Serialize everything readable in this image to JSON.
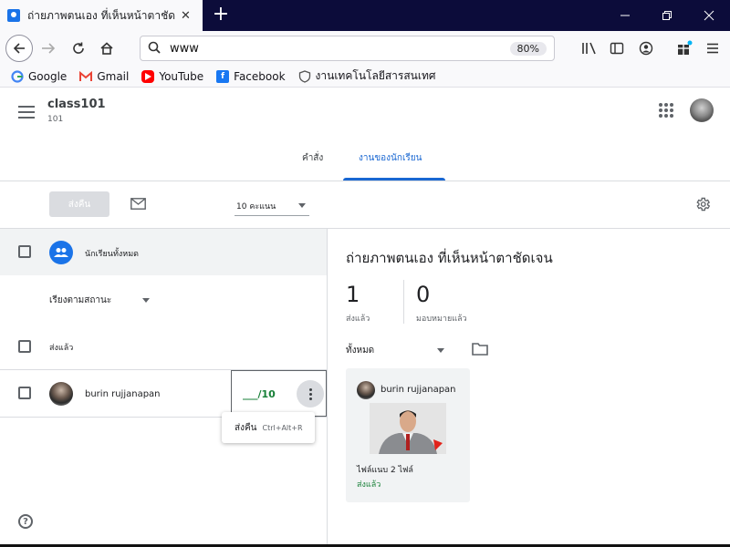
{
  "browser": {
    "tab_title": "ถ่ายภาพตนเอง ที่เห็นหน้าตาชัดเจน",
    "tab_close": "✕",
    "new_tab": "+",
    "url": "www",
    "zoom": "80%",
    "bookmarks": [
      {
        "label": "Google",
        "icon": "google-icon",
        "color": "#4285f4"
      },
      {
        "label": "Gmail",
        "icon": "gmail-icon",
        "color": "#ea4335"
      },
      {
        "label": "YouTube",
        "icon": "youtube-icon",
        "color": "#ff0000"
      },
      {
        "label": "Facebook",
        "icon": "facebook-icon",
        "color": "#1877f2"
      },
      {
        "label": "งานเทคโนโลยีสารสนเทศ",
        "icon": "shield-icon",
        "color": "#555555"
      }
    ]
  },
  "classroom": {
    "class_name": "class101",
    "section": "101",
    "tabs": [
      {
        "label": "คำสั่ง",
        "active": false
      },
      {
        "label": "งานของนักเรียน",
        "active": true
      }
    ],
    "accent_color": "#1967d2",
    "toolbar": {
      "return_label": "ส่งคืน",
      "points": "10 คะแนน"
    },
    "left": {
      "all_students": "นักเรียนทั้งหมด",
      "sort_by": "เรียงตามสถานะ",
      "section_turned_in": "ส่งแล้ว",
      "student": {
        "name": "burin rujjanapan",
        "grade": "___/10"
      },
      "menu": {
        "label": "ส่งคืน",
        "shortcut": "Ctrl+Alt+R"
      },
      "help": "?"
    },
    "right": {
      "assignment_title": "ถ่ายภาพตนเอง ที่เห็นหน้าตาชัดเจน",
      "turned_in_count": "1",
      "turned_in_label": "ส่งแล้ว",
      "assigned_count": "0",
      "assigned_label": "มอบหมายแล้ว",
      "filter": "ทั้งหมด",
      "card": {
        "student_name": "burin rujjanapan",
        "attachments": "ไฟล์แนบ 2 ไฟล์",
        "status": "ส่งแล้ว"
      }
    }
  }
}
